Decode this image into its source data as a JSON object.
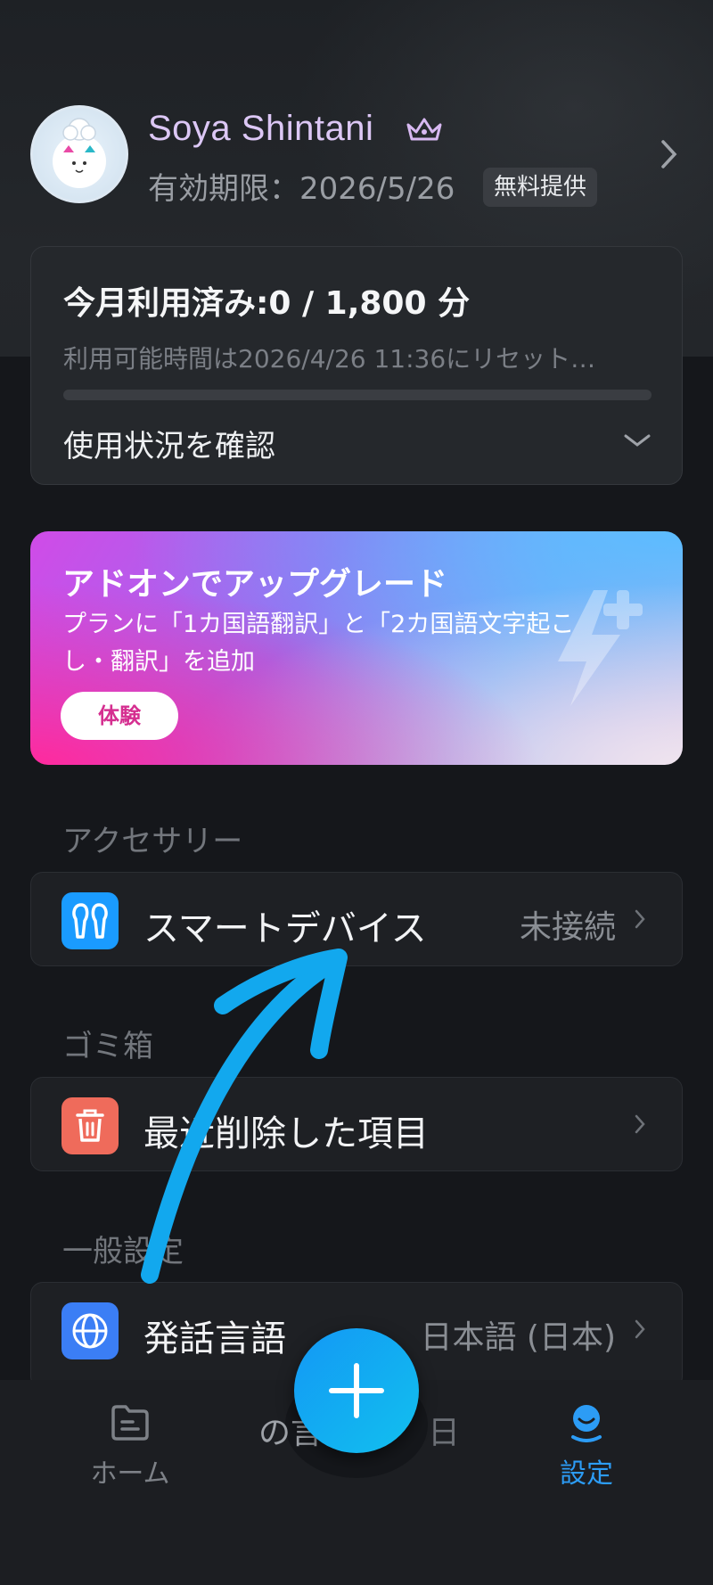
{
  "profile": {
    "name": "Soya Shintani",
    "expiry": "有効期限：2026/5/26",
    "badge": "無料提供"
  },
  "usage": {
    "title": "今月利用済み:0 / 1,800 分",
    "reset_note": "利用可能時間は2026/4/26 11:36にリセット…",
    "progress_fraction": 0,
    "check_label": "使用状況を確認"
  },
  "promo": {
    "title": "アドオンでアップグレード",
    "description": "プランに「1カ国語翻訳」と「2カ国語文字起こし・翻訳」を追加",
    "button_label": "体験"
  },
  "sections": {
    "accessory": {
      "title": "アクセサリー",
      "item_label": "スマートデバイス",
      "item_value": "未接続"
    },
    "trash": {
      "title": "ゴミ箱",
      "item_label": "最近削除した項目"
    },
    "general": {
      "title": "一般設定",
      "item_label": "発話言語",
      "item_value": "日本語 (日本)"
    }
  },
  "bottom_nav": {
    "home_label": "ホーム",
    "settings_label": "設定",
    "behind_text": "の言",
    "behind_text2": "日"
  },
  "icons": {
    "profile_chevron": "chevron-right-icon",
    "crown": "crown-icon",
    "usage_chevron": "chevron-down-icon",
    "smart_device": "earbuds-icon",
    "trash": "trash-icon",
    "language": "globe-icon",
    "home": "folder-icon",
    "settings": "person-icon",
    "fab": "plus-icon",
    "promo_deco": "lightning-plus-icon"
  },
  "colors": {
    "accent": "#2c9cf5",
    "username": "#dcc7f5",
    "device_icon_bg": "#1a9bff",
    "trash_icon_bg": "#ef6b5b",
    "language_icon_bg": "#3b7ef5",
    "annotation_arrow": "#12a8ee"
  }
}
